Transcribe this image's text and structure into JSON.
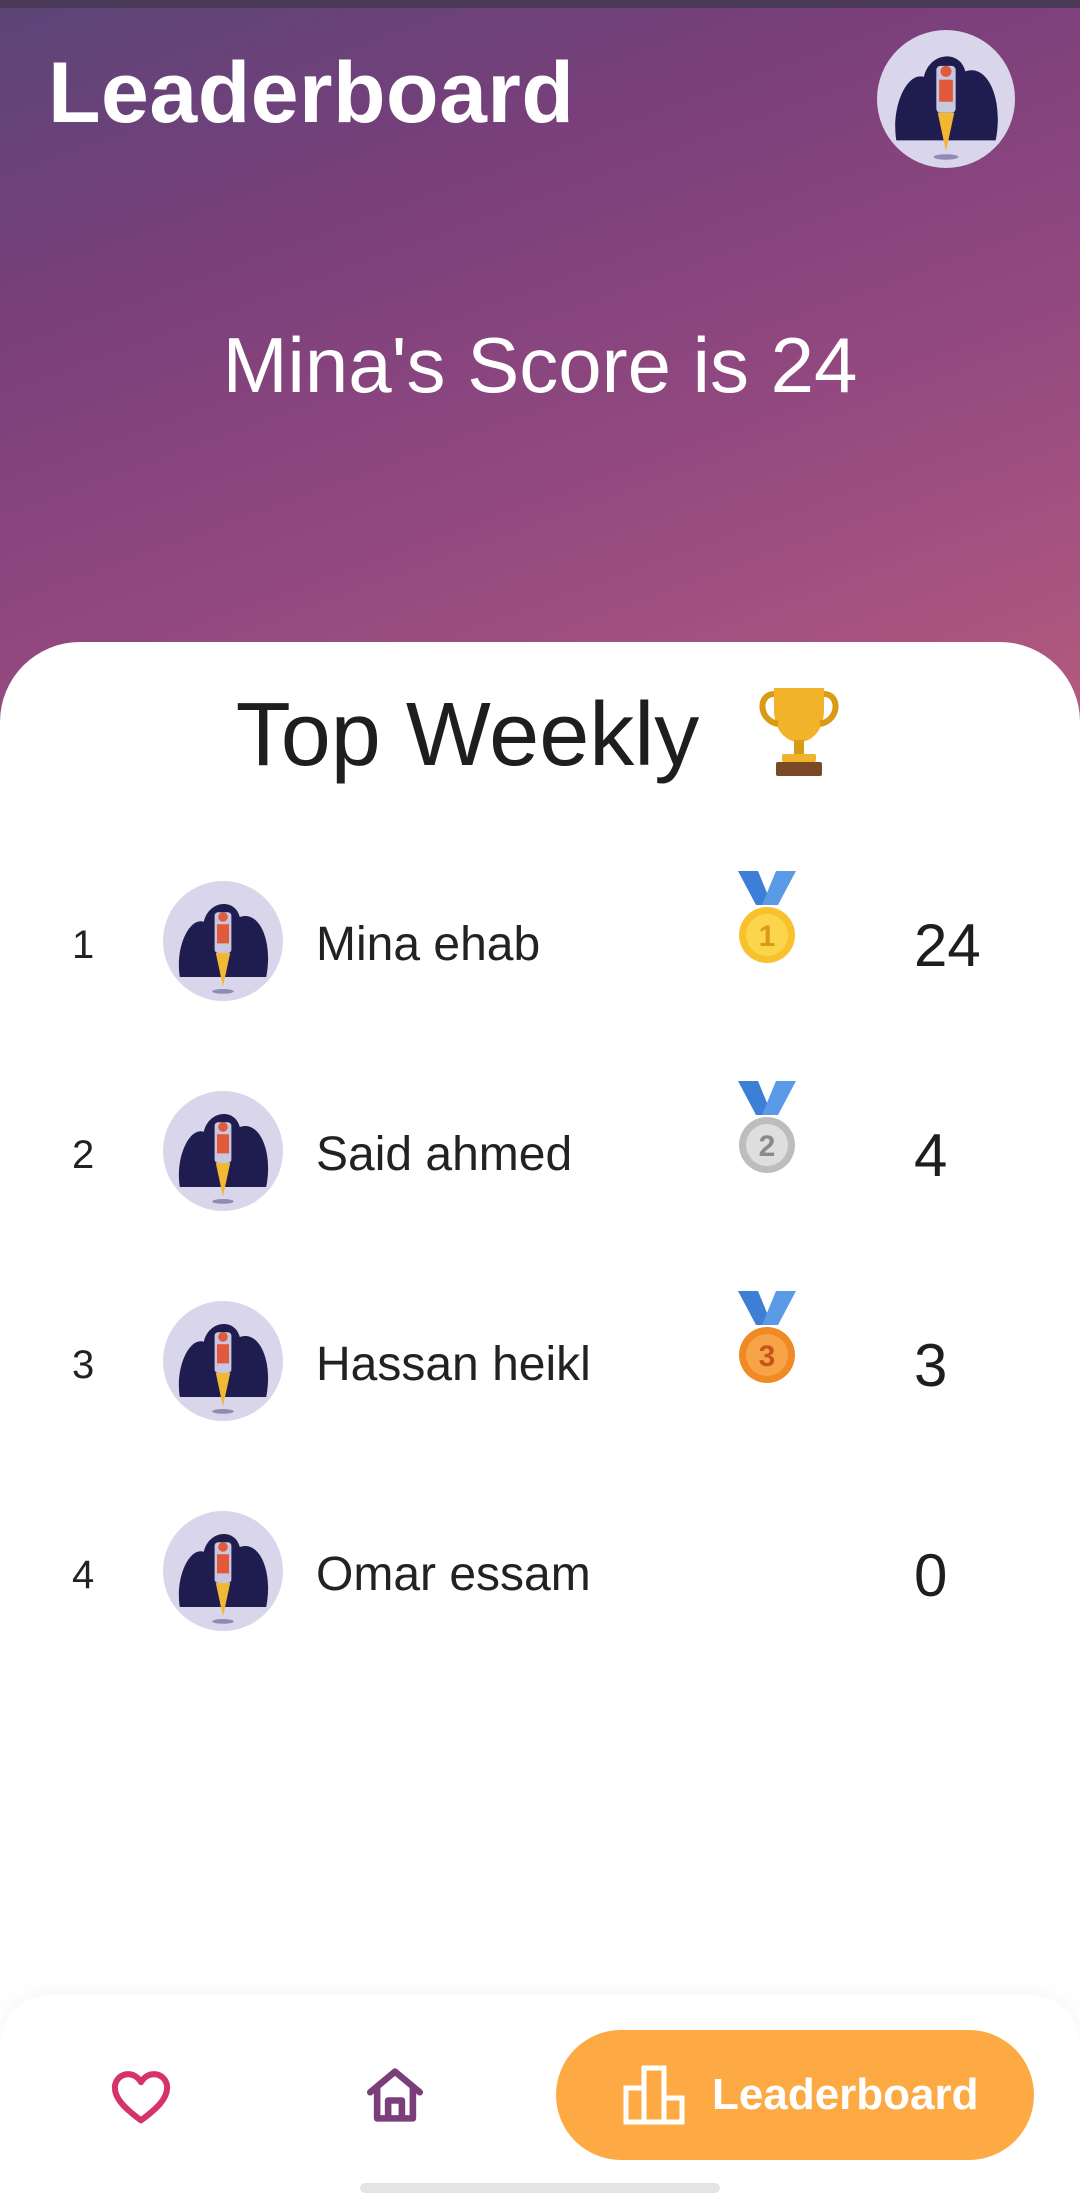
{
  "header": {
    "title": "Leaderboard",
    "score_text": "Mina's Score is 24",
    "avatar_icon": "rocket-avatar-icon"
  },
  "leaderboard": {
    "title": "Top Weekly",
    "title_icon": "trophy-icon",
    "rows": [
      {
        "rank": "1",
        "name": "Mina ehab",
        "medal": "gold-medal-icon",
        "medal_number": "1",
        "score": "24"
      },
      {
        "rank": "2",
        "name": "Said ahmed",
        "medal": "silver-medal-icon",
        "medal_number": "2",
        "score": "4"
      },
      {
        "rank": "3",
        "name": "Hassan heikl",
        "medal": "bronze-medal-icon",
        "medal_number": "3",
        "score": "3"
      },
      {
        "rank": "4",
        "name": "Omar essam",
        "medal": null,
        "score": "0"
      }
    ]
  },
  "bottom_nav": {
    "items": [
      {
        "icon": "heart-icon",
        "label": ""
      },
      {
        "icon": "home-icon",
        "label": ""
      },
      {
        "icon": "leaderboard-icon",
        "label": "Leaderboard",
        "active": true
      }
    ]
  },
  "colors": {
    "header_gradient_start": "#5a4577",
    "header_gradient_end": "#b35a7f",
    "accent": "#fdaa45",
    "heart": "#d6336c",
    "home": "#7a3f7b"
  }
}
